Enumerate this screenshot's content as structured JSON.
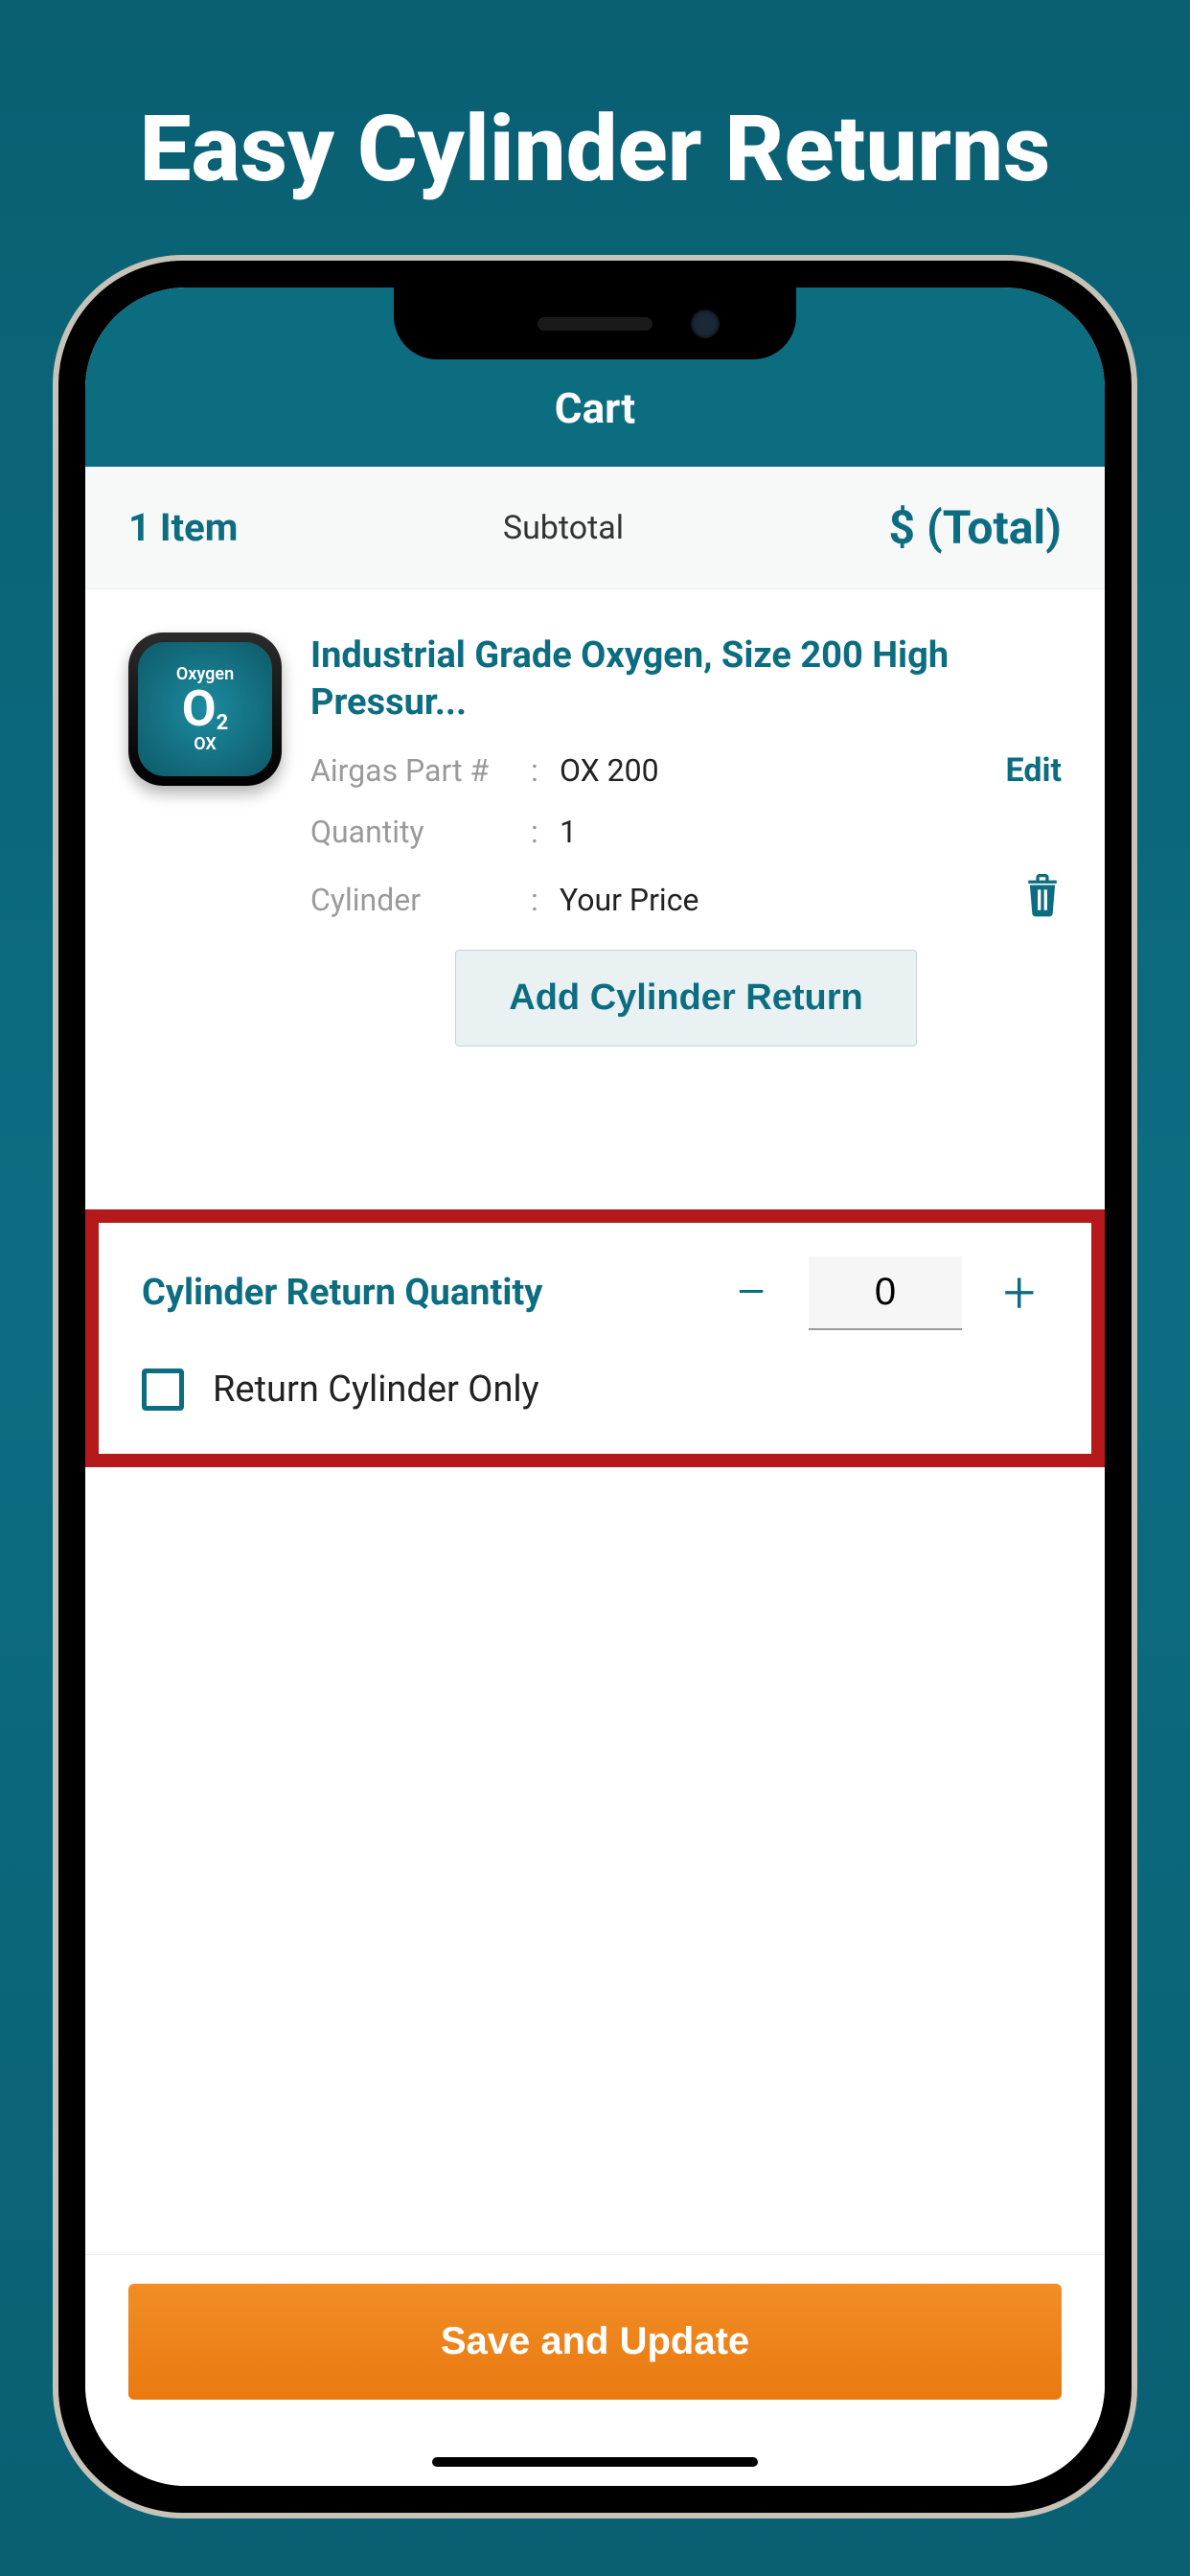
{
  "page": {
    "heading": "Easy Cylinder Returns"
  },
  "header": {
    "title": "Cart"
  },
  "summary": {
    "item_count": "1 Item",
    "subtotal_label": "Subtotal",
    "total": "$ (Total)"
  },
  "product": {
    "tile": {
      "top": "Oxygen",
      "mid": "O",
      "sub": "2",
      "bot": "OX"
    },
    "title": "Industrial Grade Oxygen, Size 200 High Pressur...",
    "part_label": "Airgas Part #",
    "part_value": "OX 200",
    "edit": "Edit",
    "qty_label": "Quantity",
    "qty_value": "1",
    "cyl_label": "Cylinder",
    "cyl_value": "Your Price",
    "add_return": "Add Cylinder Return"
  },
  "return": {
    "qty_label": "Cylinder Return Quantity",
    "qty_value": "0",
    "checkbox_label": "Return Cylinder Only"
  },
  "footer": {
    "save": "Save and Update"
  }
}
